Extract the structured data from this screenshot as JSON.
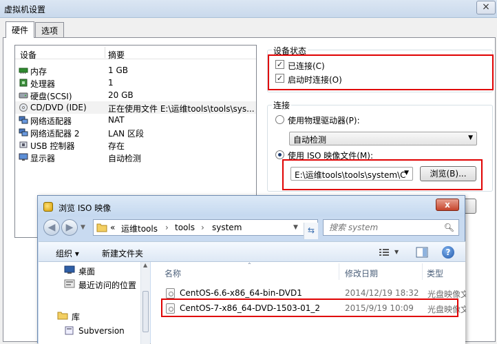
{
  "vm": {
    "title": "虚拟机设置",
    "close": "×",
    "tabs": [
      "硬件",
      "选项"
    ],
    "device_list": {
      "col_device": "设备",
      "col_summary": "摘要",
      "rows": [
        {
          "name": "内存",
          "summary": "1 GB"
        },
        {
          "name": "处理器",
          "summary": "1"
        },
        {
          "name": "硬盘(SCSI)",
          "summary": "20 GB"
        },
        {
          "name": "CD/DVD (IDE)",
          "summary": "正在使用文件 E:\\运维tools\\tools\\sys..."
        },
        {
          "name": "网络适配器",
          "summary": "NAT"
        },
        {
          "name": "网络适配器 2",
          "summary": "LAN 区段"
        },
        {
          "name": "USB 控制器",
          "summary": "存在"
        },
        {
          "name": "显示器",
          "summary": "自动检测"
        }
      ]
    },
    "device_status": {
      "title": "设备状态",
      "connected": "已连接(C)",
      "connect_at_power_on": "启动时连接(O)"
    },
    "connection": {
      "title": "连接",
      "physical_drive": "使用物理驱动器(P):",
      "physical_drive_value": "自动检测",
      "iso_image": "使用 ISO 映像文件(M):",
      "iso_path": "E:\\运维tools\\tools\\system\\C",
      "browse": "浏览(B)..."
    }
  },
  "iso": {
    "title": "浏览 ISO 映像",
    "close": "x",
    "address": {
      "prefix": "«",
      "parts": [
        "运维tools",
        "tools",
        "system"
      ]
    },
    "search_placeholder": "搜索 system",
    "toolbar": {
      "organize": "组织 ▾",
      "new_folder": "新建文件夹"
    },
    "nav": [
      {
        "label": "桌面"
      },
      {
        "label": "最近访问的位置"
      },
      {
        "label": "库"
      },
      {
        "label": "Subversion"
      }
    ],
    "columns": {
      "name": "名称",
      "date": "修改日期",
      "type": "类型"
    },
    "files": [
      {
        "name": "CentOS-6.6-x86_64-bin-DVD1",
        "date": "2014/12/19 18:32",
        "type": "光盘映像文件"
      },
      {
        "name": "CentOS-7-x86_64-DVD-1503-01_2",
        "date": "2015/9/19 10:09",
        "type": "光盘映像文件"
      }
    ]
  },
  "colors": {
    "highlight_box": "#e00000",
    "title_bar": "#c9d9ec"
  }
}
